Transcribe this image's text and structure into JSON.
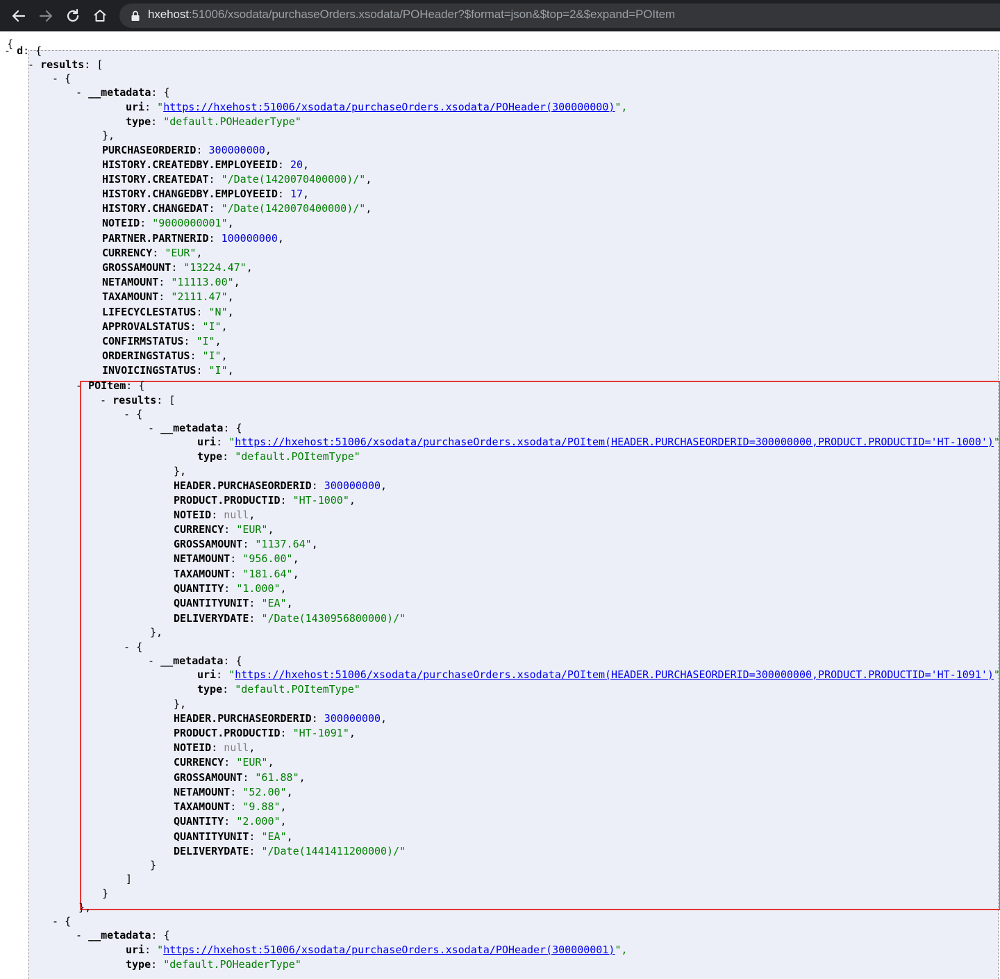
{
  "browser": {
    "url_host": "hxehost",
    "url_rest": ":51006/xsodata/purchaseOrders.xsodata/POHeader?$format=json&$top=2&$expand=POItem"
  },
  "json": {
    "open_brace": "{",
    "lines": [
      {
        "t": "- ",
        "k": "d",
        "v": "{"
      },
      {
        "t": "- ",
        "k": "results",
        "v": "["
      },
      {
        "t": "- ",
        "v": "{"
      },
      {
        "t": "- ",
        "k": "__metadata",
        "v": "{"
      },
      {
        "k": "uri",
        "pre": "\"",
        "link": "https://hxehost:51006/xsodata/purchaseOrders.xsodata/POHeader(300000000)",
        "post": "\","
      },
      {
        "k": "type",
        "s": "\"default.POHeaderType\""
      },
      {
        "v": "},"
      },
      {
        "k": "PURCHASEORDERID",
        "n": "300000000",
        "post": ","
      },
      {
        "k": "HISTORY.CREATEDBY.EMPLOYEEID",
        "n": "20",
        "post": ","
      },
      {
        "k": "HISTORY.CREATEDAT",
        "s": "\"/Date(1420070400000)/\"",
        "post": ","
      },
      {
        "k": "HISTORY.CHANGEDBY.EMPLOYEEID",
        "n": "17",
        "post": ","
      },
      {
        "k": "HISTORY.CHANGEDAT",
        "s": "\"/Date(1420070400000)/\"",
        "post": ","
      },
      {
        "k": "NOTEID",
        "s": "\"9000000001\"",
        "post": ","
      },
      {
        "k": "PARTNER.PARTNERID",
        "n": "100000000",
        "post": ","
      },
      {
        "k": "CURRENCY",
        "s": "\"EUR\"",
        "post": ","
      },
      {
        "k": "GROSSAMOUNT",
        "s": "\"13224.47\"",
        "post": ","
      },
      {
        "k": "NETAMOUNT",
        "s": "\"11113.00\"",
        "post": ","
      },
      {
        "k": "TAXAMOUNT",
        "s": "\"2111.47\"",
        "post": ","
      },
      {
        "k": "LIFECYCLESTATUS",
        "s": "\"N\"",
        "post": ","
      },
      {
        "k": "APPROVALSTATUS",
        "s": "\"I\"",
        "post": ","
      },
      {
        "k": "CONFIRMSTATUS",
        "s": "\"I\"",
        "post": ","
      },
      {
        "k": "ORDERINGSTATUS",
        "s": "\"I\"",
        "post": ","
      },
      {
        "k": "INVOICINGSTATUS",
        "s": "\"I\"",
        "post": ","
      },
      {
        "t": "- ",
        "k": "POItem",
        "v": "{"
      },
      {
        "t": "- ",
        "k": "results",
        "v": "["
      },
      {
        "t": "- ",
        "v": "{"
      },
      {
        "t": "- ",
        "k": "__metadata",
        "v": "{"
      },
      {
        "k": "uri",
        "pre": "\"",
        "link": "https://hxehost:51006/xsodata/purchaseOrders.xsodata/POItem(HEADER.PURCHASEORDERID=300000000,PRODUCT.PRODUCTID='HT-1000')",
        "post": "\","
      },
      {
        "k": "type",
        "s": "\"default.POItemType\""
      },
      {
        "v": "},"
      },
      {
        "k": "HEADER.PURCHASEORDERID",
        "n": "300000000",
        "post": ","
      },
      {
        "k": "PRODUCT.PRODUCTID",
        "s": "\"HT-1000\"",
        "post": ","
      },
      {
        "k": "NOTEID",
        "nl": "null",
        "post": ","
      },
      {
        "k": "CURRENCY",
        "s": "\"EUR\"",
        "post": ","
      },
      {
        "k": "GROSSAMOUNT",
        "s": "\"1137.64\"",
        "post": ","
      },
      {
        "k": "NETAMOUNT",
        "s": "\"956.00\"",
        "post": ","
      },
      {
        "k": "TAXAMOUNT",
        "s": "\"181.64\"",
        "post": ","
      },
      {
        "k": "QUANTITY",
        "s": "\"1.000\"",
        "post": ","
      },
      {
        "k": "QUANTITYUNIT",
        "s": "\"EA\"",
        "post": ","
      },
      {
        "k": "DELIVERYDATE",
        "s": "\"/Date(1430956800000)/\""
      },
      {
        "v": "},"
      },
      {
        "t": "- ",
        "v": "{"
      },
      {
        "t": "- ",
        "k": "__metadata",
        "v": "{"
      },
      {
        "k": "uri",
        "pre": "\"",
        "link": "https://hxehost:51006/xsodata/purchaseOrders.xsodata/POItem(HEADER.PURCHASEORDERID=300000000,PRODUCT.PRODUCTID='HT-1091')",
        "post": "\","
      },
      {
        "k": "type",
        "s": "\"default.POItemType\""
      },
      {
        "v": "},"
      },
      {
        "k": "HEADER.PURCHASEORDERID",
        "n": "300000000",
        "post": ","
      },
      {
        "k": "PRODUCT.PRODUCTID",
        "s": "\"HT-1091\"",
        "post": ","
      },
      {
        "k": "NOTEID",
        "nl": "null",
        "post": ","
      },
      {
        "k": "CURRENCY",
        "s": "\"EUR\"",
        "post": ","
      },
      {
        "k": "GROSSAMOUNT",
        "s": "\"61.88\"",
        "post": ","
      },
      {
        "k": "NETAMOUNT",
        "s": "\"52.00\"",
        "post": ","
      },
      {
        "k": "TAXAMOUNT",
        "s": "\"9.88\"",
        "post": ","
      },
      {
        "k": "QUANTITY",
        "s": "\"2.000\"",
        "post": ","
      },
      {
        "k": "QUANTITYUNIT",
        "s": "\"EA\"",
        "post": ","
      },
      {
        "k": "DELIVERYDATE",
        "s": "\"/Date(1441411200000)/\""
      },
      {
        "v": "}"
      },
      {
        "v": "]"
      },
      {
        "v": "}"
      },
      {
        "v": "},"
      },
      {
        "t": "- ",
        "v": "{"
      },
      {
        "t": "- ",
        "k": "__metadata",
        "v": "{"
      },
      {
        "k": "uri",
        "pre": "\"",
        "link": "https://hxehost:51006/xsodata/purchaseOrders.xsodata/POHeader(300000001)",
        "post": "\","
      },
      {
        "k": "type",
        "s": "\"default.POHeaderType\""
      }
    ]
  }
}
